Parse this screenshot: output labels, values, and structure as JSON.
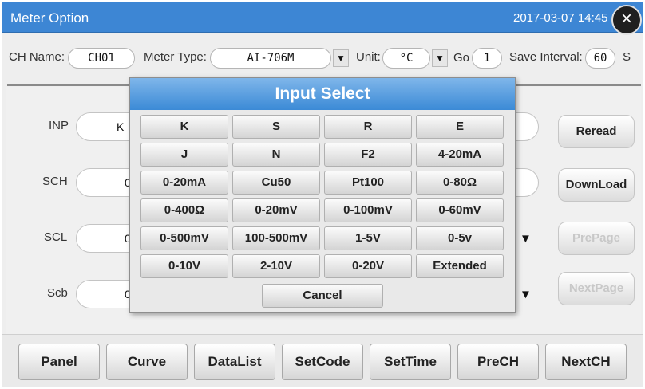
{
  "window": {
    "title": "Meter Option",
    "datetime": "2017-03-07 14:45",
    "close_glyph": "×"
  },
  "header_fields": {
    "ch_name_label": "CH Name:",
    "ch_name_value": "CH01",
    "meter_type_label": "Meter Type:",
    "meter_type_value": "AI-706M",
    "unit_label": "Unit:",
    "unit_value": "°C",
    "go_label": "Go",
    "go_value": "1",
    "save_interval_label": "Save Interval:",
    "save_interval_value": "60",
    "save_interval_unit": "S",
    "dropdown_glyph": "▼"
  },
  "rows": [
    {
      "label": "INP",
      "value": "K"
    },
    {
      "label": "SCH",
      "value": "0"
    },
    {
      "label": "SCL",
      "value": "0"
    },
    {
      "label": "Scb",
      "value": "0"
    }
  ],
  "side_buttons": {
    "reread": "Reread",
    "download": "DownLoad",
    "prepage": "PrePage",
    "nextpage": "NextPage"
  },
  "bottom_buttons": [
    "Panel",
    "Curve",
    "DataList",
    "SetCode",
    "SetTime",
    "PreCH",
    "NextCH"
  ],
  "dialog": {
    "title": "Input Select",
    "options": [
      "K",
      "S",
      "R",
      "E",
      "J",
      "N",
      "F2",
      "4-20mA",
      "0-20mA",
      "Cu50",
      "Pt100",
      "0-80Ω",
      "0-400Ω",
      "0-20mV",
      "0-100mV",
      "0-60mV",
      "0-500mV",
      "100-500mV",
      "1-5V",
      "0-5v",
      "0-10V",
      "2-10V",
      "0-20V",
      "Extended"
    ],
    "cancel": "Cancel"
  }
}
